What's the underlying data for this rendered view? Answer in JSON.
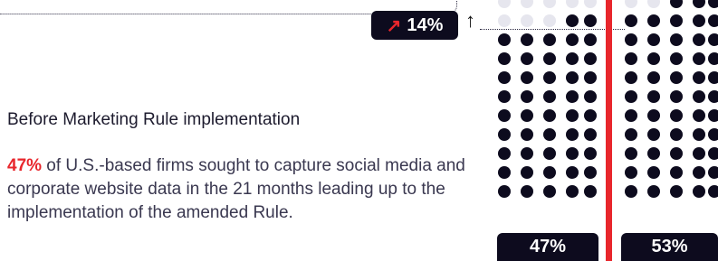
{
  "callout": {
    "change": "14%",
    "trend_icon": "arrow-up-right-icon",
    "arrow_icon": "arrow-up-icon"
  },
  "section": {
    "heading": "Before Marketing Rule implementation",
    "highlight": "47%",
    "body": " of U.S.-based firms sought to capture social media and corporate website data in the 21 months leading up to the implementation of the amended Rule."
  },
  "bars": {
    "before_label": "47%",
    "after_label": "53%"
  },
  "colors": {
    "accent": "#e8262c",
    "dark": "#0d0b1e",
    "dot_light": "#e6e6ee"
  }
}
